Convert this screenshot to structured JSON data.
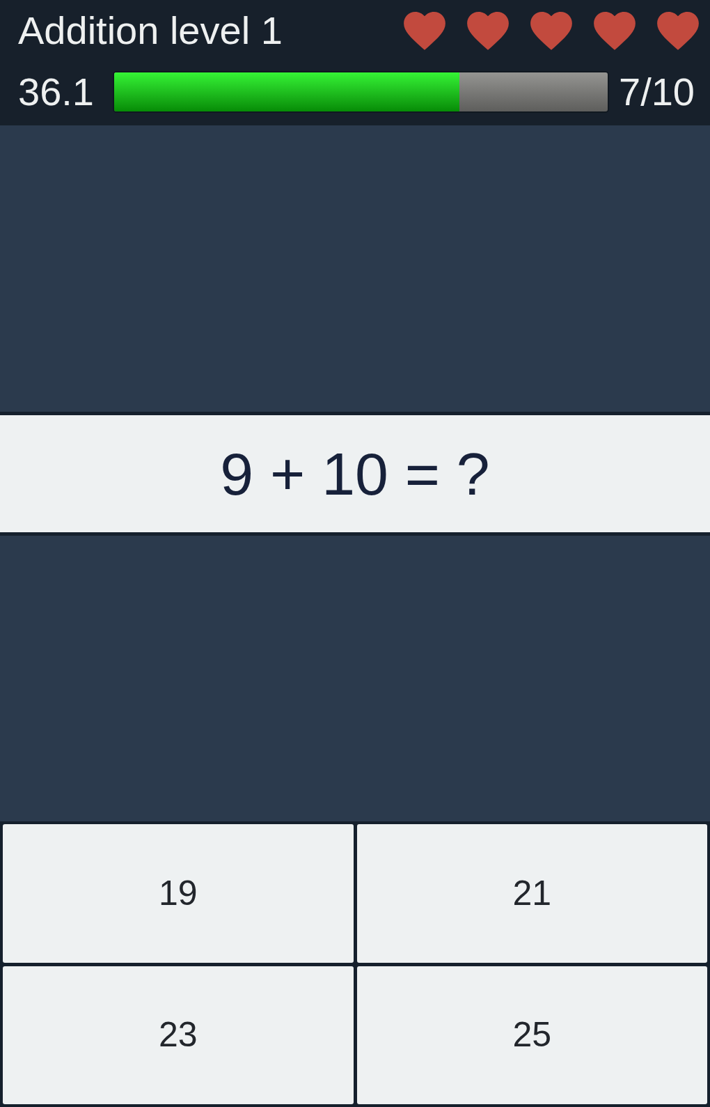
{
  "header": {
    "title": "Addition level 1",
    "hearts": [
      {
        "filled": true
      },
      {
        "filled": true
      },
      {
        "filled": true
      },
      {
        "filled": true
      },
      {
        "filled": true
      }
    ],
    "time": "36.1",
    "progress": {
      "level": 0.7,
      "count": "7/10"
    }
  },
  "question": "9 + 10 = ?",
  "answers": [
    "19",
    "21",
    "23",
    "25"
  ]
}
